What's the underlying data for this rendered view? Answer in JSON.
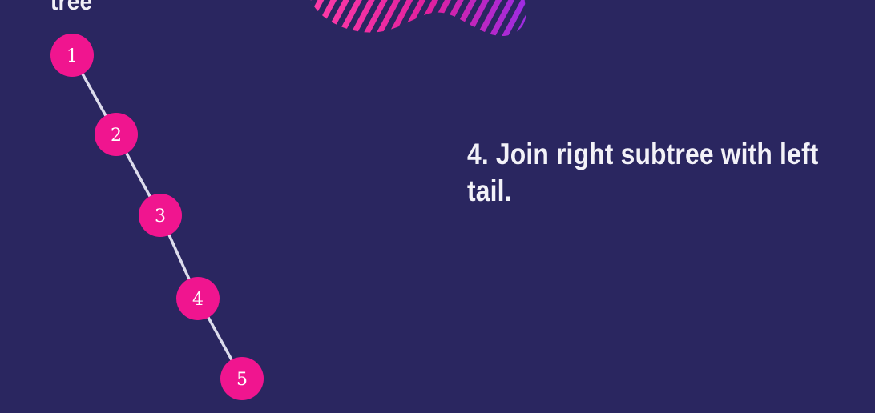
{
  "heading": {
    "partial_title": "tree"
  },
  "instruction": {
    "step_text": "4. Join right subtree with left tail."
  },
  "tree": {
    "nodes": [
      "1",
      "2",
      "3",
      "4",
      "5"
    ],
    "edges": [
      [
        "1",
        "2"
      ],
      [
        "2",
        "3"
      ],
      [
        "3",
        "4"
      ],
      [
        "4",
        "5"
      ]
    ]
  },
  "colors": {
    "background": "#2a2660",
    "node_fill": "#f0158f",
    "edge_stroke": "#dcdcec",
    "text": "#f3f2f8",
    "decor_stripe_start": "#ff3ca8",
    "decor_stripe_end": "#9c2ce2"
  }
}
